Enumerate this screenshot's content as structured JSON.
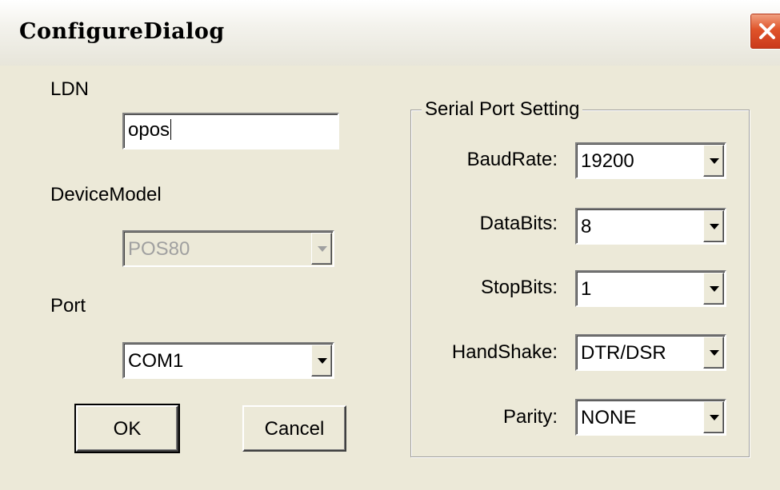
{
  "window": {
    "title": "ConfigureDialog"
  },
  "left": {
    "ldn_label": "LDN",
    "ldn_value": "opos",
    "device_model_label": "DeviceModel",
    "device_model_value": "POS80",
    "port_label": "Port",
    "port_value": "COM1"
  },
  "buttons": {
    "ok": "OK",
    "cancel": "Cancel"
  },
  "serial": {
    "group_label": "Serial Port Setting",
    "fields": [
      {
        "label": "BaudRate:",
        "value": "19200"
      },
      {
        "label": "DataBits:",
        "value": "8"
      },
      {
        "label": "StopBits:",
        "value": "1"
      },
      {
        "label": "HandShake:",
        "value": "DTR/DSR"
      },
      {
        "label": "Parity:",
        "value": "NONE"
      }
    ]
  },
  "colors": {
    "dialog_bg": "#ece9d8",
    "close_button": "#e0542a"
  }
}
